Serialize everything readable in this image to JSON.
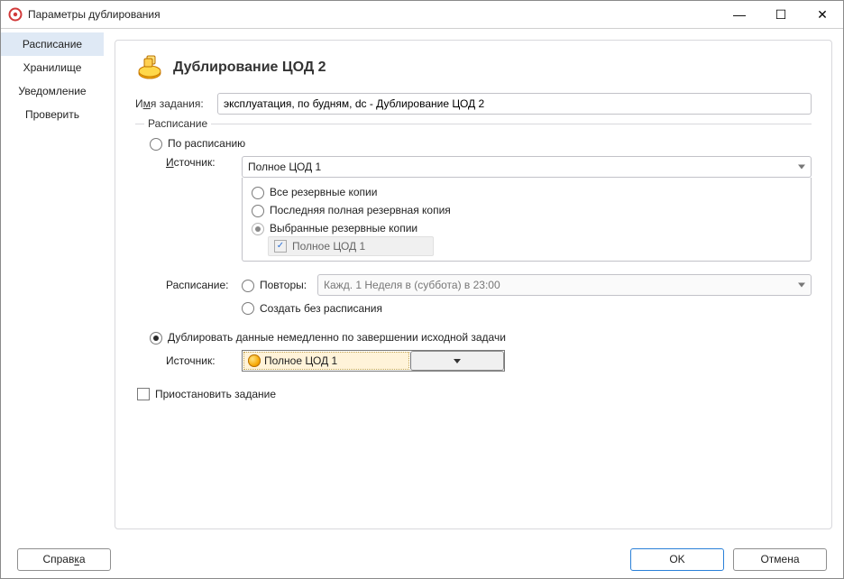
{
  "window": {
    "title": "Параметры дублирования"
  },
  "winbuttons": {
    "min": "—",
    "max": "☐",
    "close": "✕"
  },
  "sidebar": {
    "items": [
      {
        "label": "Расписание",
        "active": true
      },
      {
        "label": "Хранилище"
      },
      {
        "label": "Уведомление"
      },
      {
        "label": "Проверить"
      }
    ]
  },
  "header": {
    "title": "Дублирование ЦОД 2"
  },
  "form": {
    "jobname_label_pre": "И",
    "jobname_label_u": "м",
    "jobname_label_post": "я задания:",
    "jobname_value": "эксплуатация, по будням, dc - Дублирование ЦОД 2",
    "fieldset_legend": "Расписание",
    "opt_schedule_label": "По расписанию",
    "source_label_pre": "",
    "source_label_u": "И",
    "source_label_post": "сточник:",
    "source_value": "Полное ЦОД 1",
    "source_options": {
      "all": "Все резервные копии",
      "last_full": "Последняя полная резервная копия",
      "selected": "Выбранные резервные копии",
      "selected_item": "Полное ЦОД 1"
    },
    "schedule_label_pre": "",
    "schedule_label_u": "Р",
    "schedule_label_post": "асписание:",
    "repeats_pre": "Пов",
    "repeats_u": "т",
    "repeats_post": "оры:",
    "repeats_value": "Кажд. 1 Неделя в (суббота) в 23:00",
    "no_schedule_pre": "Создать ",
    "no_schedule_u": "б",
    "no_schedule_post": "ез расписания",
    "opt_immediate_label": "Дублировать данные немедленно по завершении исходной задачи",
    "immediate_source_label": "Источник:",
    "immediate_source_value": "Полное ЦОД 1",
    "suspend_label": "Приостановить задание"
  },
  "footer": {
    "help_pre": "Справ",
    "help_u": "к",
    "help_post": "а",
    "ok": "OK",
    "cancel": "Отмена"
  }
}
